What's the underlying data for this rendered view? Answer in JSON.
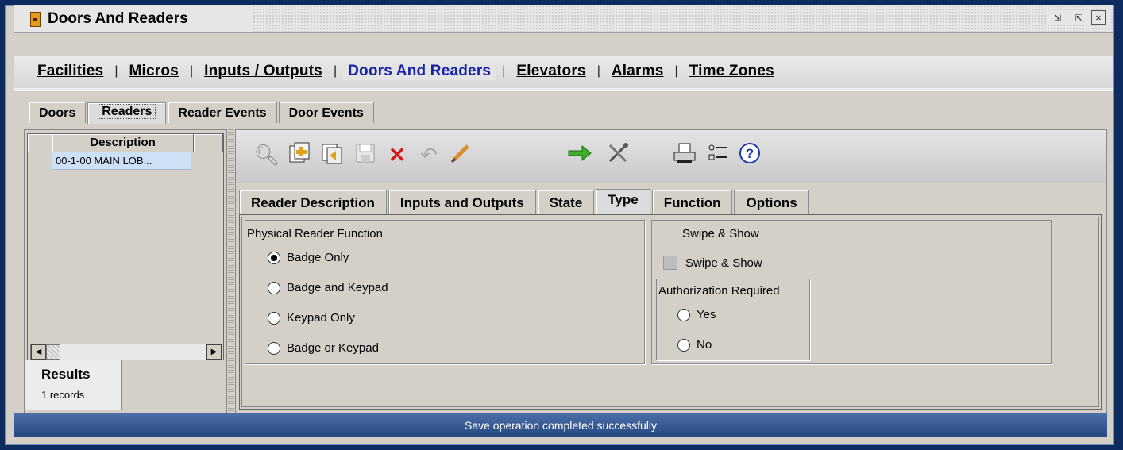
{
  "window": {
    "title": "Doors And Readers",
    "controls": [
      "restore-icon",
      "maximize-icon",
      "close-icon"
    ]
  },
  "nav": {
    "items": [
      {
        "label": "Facilities"
      },
      {
        "label": "Micros"
      },
      {
        "label": "Inputs / Outputs"
      },
      {
        "label": "Doors And Readers",
        "active": true
      },
      {
        "label": "Elevators"
      },
      {
        "label": "Alarms"
      },
      {
        "label": "Time Zones"
      }
    ],
    "separator": "|"
  },
  "left_tabs": [
    "Doors",
    "Readers",
    "Reader Events",
    "Door Events"
  ],
  "left_tabs_active": "Readers",
  "list": {
    "header": "Description",
    "rows": [
      "00-1-00 MAIN LOB..."
    ]
  },
  "results": {
    "title": "Results",
    "count": "1 records"
  },
  "toolbar": {
    "icons": [
      "search-icon",
      "add-icon",
      "copy-icon",
      "save-icon",
      "delete-icon",
      "undo-icon",
      "edit-icon",
      "go-icon",
      "tools-icon",
      "print-icon",
      "list-options-icon",
      "help-icon"
    ]
  },
  "sub_tabs": [
    "Reader Description",
    "Inputs and Outputs",
    "State",
    "Type",
    "Function",
    "Options"
  ],
  "sub_tabs_active": "Type",
  "physical_reader": {
    "label": "Physical Reader Function",
    "options": [
      {
        "label": "Badge Only",
        "checked": true
      },
      {
        "label": "Badge and Keypad",
        "checked": false
      },
      {
        "label": "Keypad Only",
        "checked": false
      },
      {
        "label": "Badge or Keypad",
        "checked": false
      }
    ]
  },
  "swipe_show": {
    "group_label": "Swipe & Show",
    "checkbox_label": "Swipe & Show",
    "checked": false
  },
  "authorization": {
    "label": "Authorization Required",
    "options": [
      {
        "label": "Yes",
        "checked": false
      },
      {
        "label": "No",
        "checked": false
      }
    ]
  },
  "status": {
    "message": "Save operation completed successfully"
  },
  "colors": {
    "active_nav": "#1421a8",
    "status_bar": "#234782",
    "selected_row": "#cde0f6",
    "delete_icon": "#d21a1a"
  }
}
